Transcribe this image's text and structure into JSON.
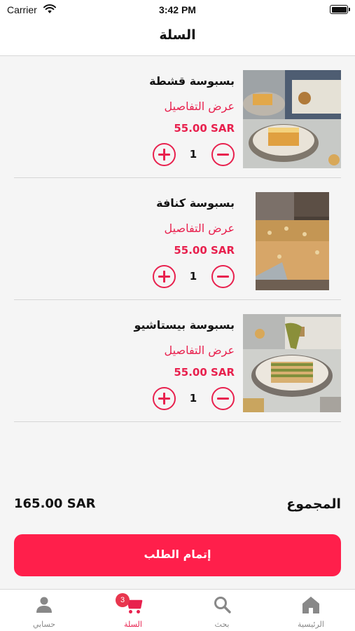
{
  "status_bar": {
    "carrier": "Carrier",
    "time": "3:42 PM"
  },
  "header": {
    "title": "السلة"
  },
  "cart": {
    "items": [
      {
        "name": "بسبوسة قشطة",
        "details_link": "عرض التفاصيل",
        "price": "55.00 SAR",
        "quantity": "1"
      },
      {
        "name": "بسبوسة كنافة",
        "details_link": "عرض التفاصيل",
        "price": "55.00 SAR",
        "quantity": "1"
      },
      {
        "name": "بسبوسة بيستاشيو",
        "details_link": "عرض التفاصيل",
        "price": "55.00 SAR",
        "quantity": "1"
      }
    ]
  },
  "summary": {
    "total_label": "المجموع",
    "total_amount": "165.00 SAR"
  },
  "checkout": {
    "label": "إتمام الطلب"
  },
  "tab_bar": {
    "tabs": [
      {
        "label": "الرئيسية",
        "icon": "home-icon"
      },
      {
        "label": "بحث",
        "icon": "search-icon"
      },
      {
        "label": "السلة",
        "icon": "cart-icon",
        "badge": "3",
        "active": true
      },
      {
        "label": "حسابي",
        "icon": "person-icon"
      }
    ]
  },
  "colors": {
    "accent": "#e8214e",
    "button": "#ff1f4b",
    "tab_inactive": "#888888",
    "badge": "#e8364e"
  }
}
